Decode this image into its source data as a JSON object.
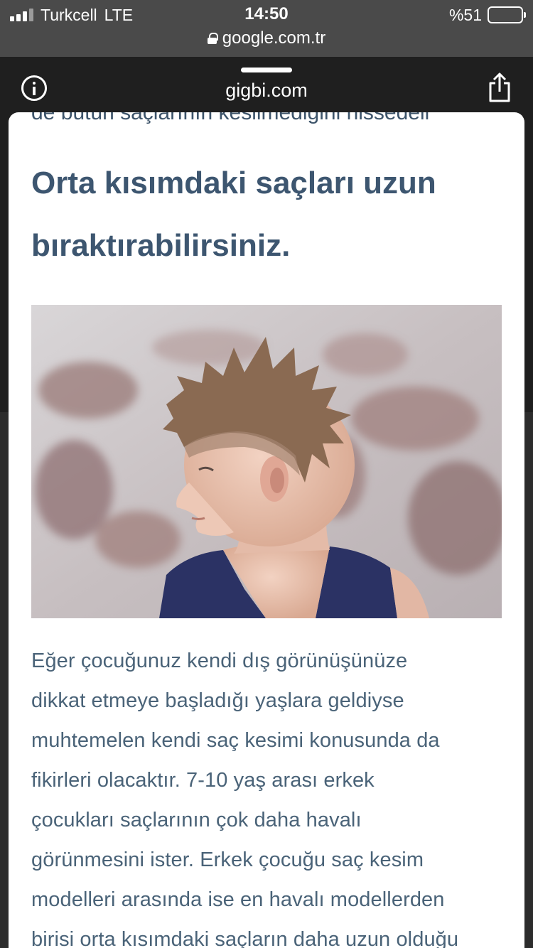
{
  "status_bar": {
    "carrier": "Turkcell",
    "network": "LTE",
    "time": "14:50",
    "battery": "%51",
    "battery_level": 0.51,
    "url": "google.com.tr"
  },
  "sheet": {
    "title": "gigbi.com",
    "icons": [
      "info-icon",
      "share-icon"
    ]
  },
  "article": {
    "cut_off_text": "de bütün saçlarının kesilmediğini hissedell",
    "heading": "Orta kısımdaki saçları uzun bıraktırabilirsiniz.",
    "body_lines": [
      "Eğer çocuğunuz kendi dış görünüşünüze",
      "dikkat etmeye başladığı yaşlara geldiyse",
      "muhtemelen kendi saç kesimi konusunda da",
      "fikirleri olacaktır. 7-10 yaş arası erkek",
      "çocukları saçlarının çok daha havalı",
      "görünmesini ister. Erkek çocuğu saç kesim",
      "modelleri arasında ise en havalı modellerden",
      "birisi orta kısımdaki saçların daha uzun olduğu"
    ]
  },
  "colors": {
    "heading": "#3d5670",
    "body": "#4a6378",
    "status_bar_bg": "#4a4a4a"
  }
}
